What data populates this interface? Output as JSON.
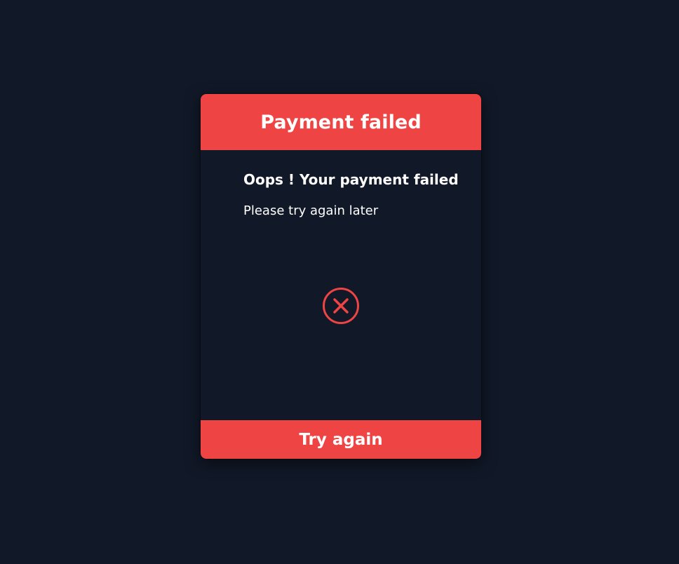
{
  "modal": {
    "title": "Payment failed",
    "message_title": "Oops ! Your payment failed",
    "message_subtitle": "Please try again later",
    "icon": "circle-x-icon",
    "retry_label": "Try again"
  },
  "colors": {
    "background": "#111827",
    "accent": "#EF4444",
    "text": "#FFFFFF"
  }
}
